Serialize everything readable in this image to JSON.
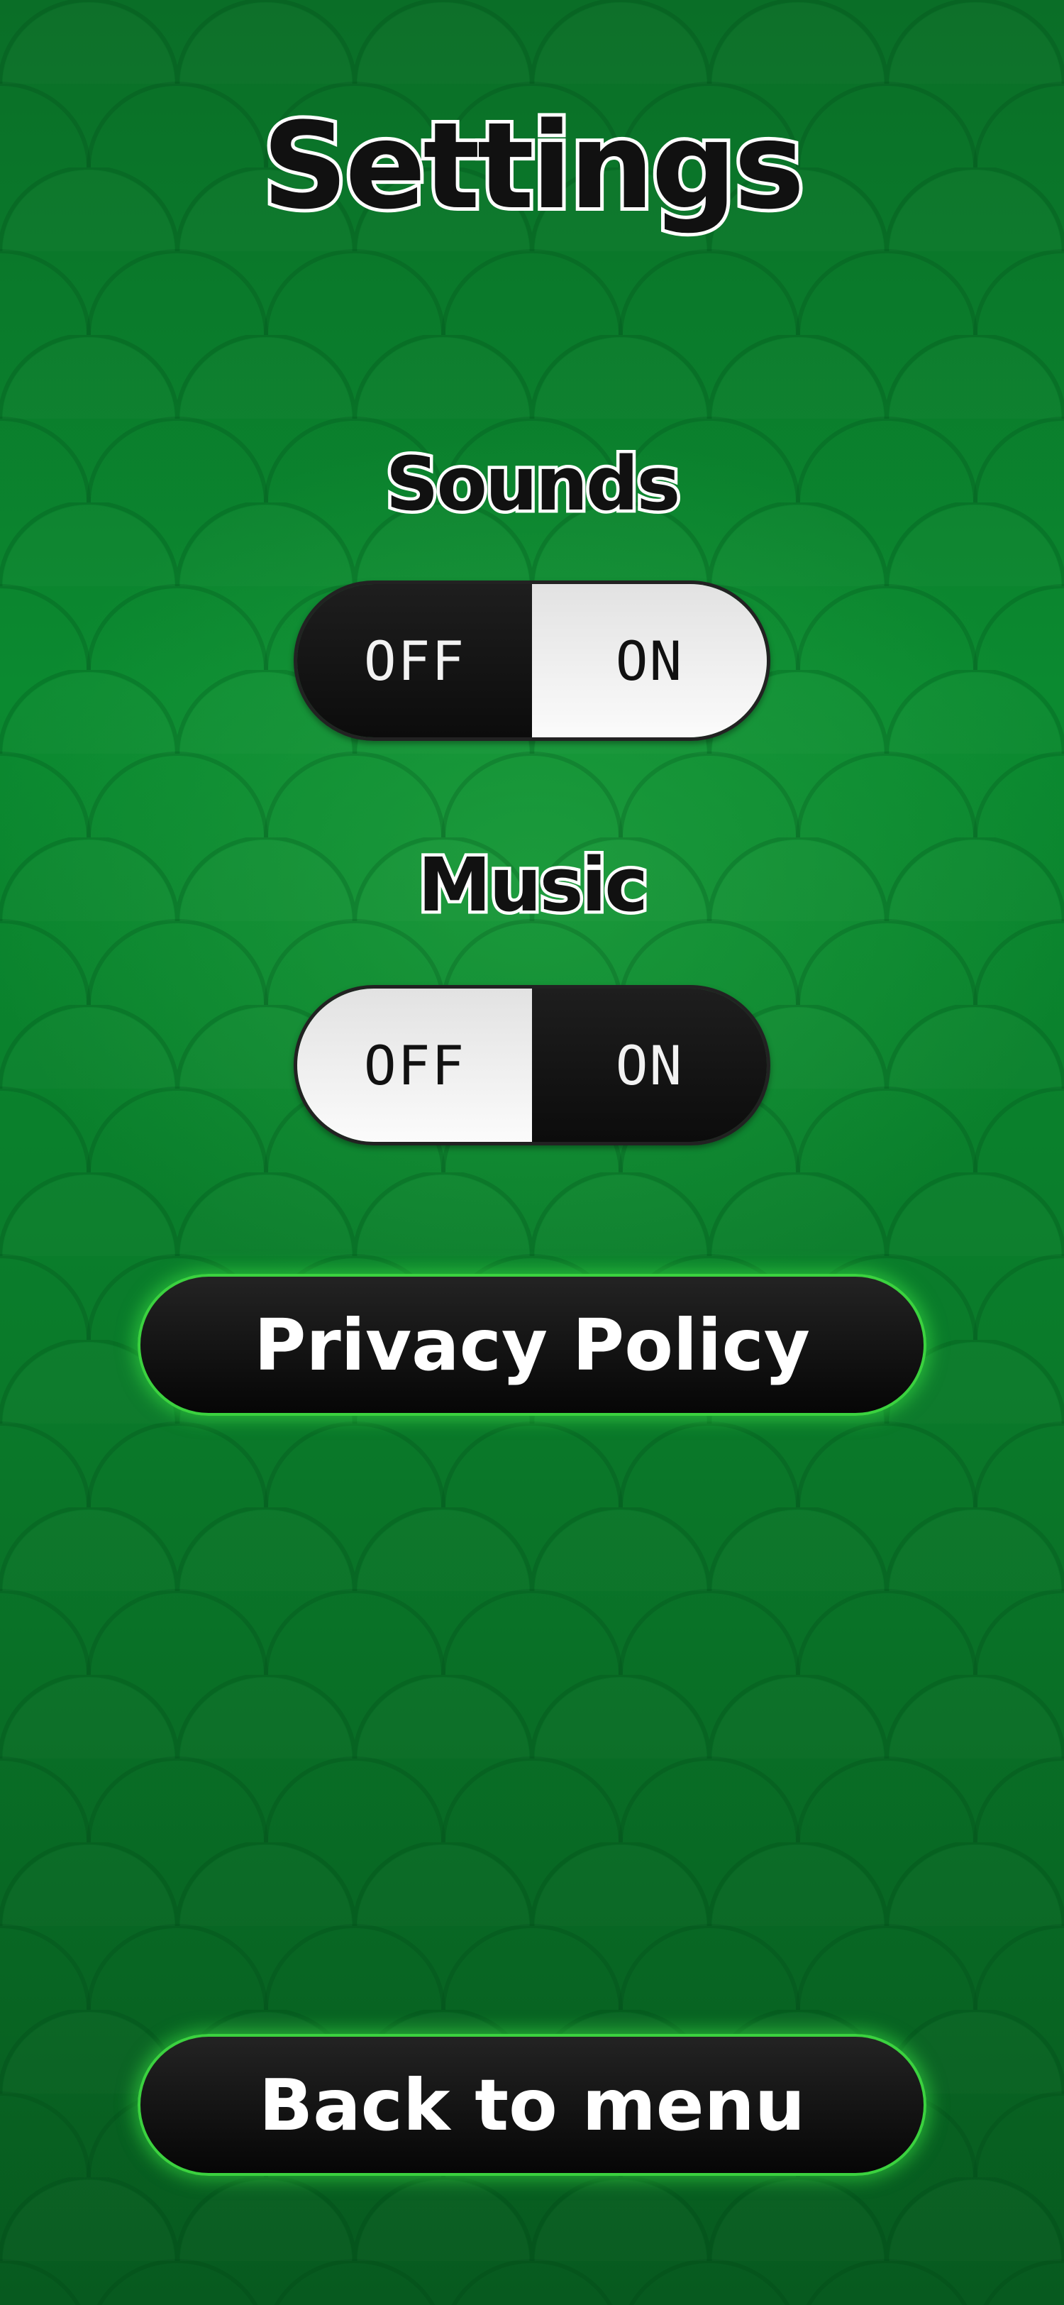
{
  "colors": {
    "background": "#0b7a2c",
    "button_glow": "#3bd23f",
    "button_fill": "#0c0c0c",
    "toggle_active": "#f2f2f2",
    "toggle_inactive": "#111111"
  },
  "header": {
    "title": "Settings"
  },
  "settings": {
    "sounds": {
      "label": "Sounds",
      "off_label": "OFF",
      "on_label": "ON",
      "selected": "OFF"
    },
    "music": {
      "label": "Music",
      "off_label": "OFF",
      "on_label": "ON",
      "selected": "ON"
    }
  },
  "buttons": {
    "privacy_policy": "Privacy Policy",
    "back_to_menu": "Back to menu"
  }
}
